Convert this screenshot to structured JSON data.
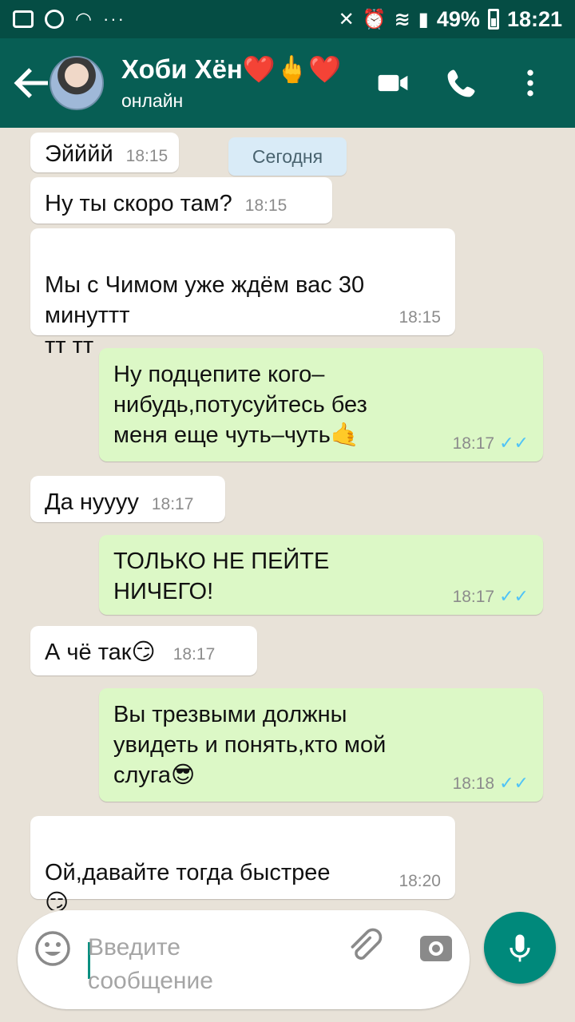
{
  "status_bar": {
    "dots": "···",
    "battery": "49%",
    "time": "18:21"
  },
  "header": {
    "contact_name": "Хоби Хён❤️🖕❤️",
    "status": "онлайн"
  },
  "date_chip": "Сегодня",
  "messages": [
    {
      "dir": "in",
      "text": "Эйййй",
      "time": "18:15"
    },
    {
      "dir": "in",
      "text": "Ну ты скоро там?",
      "time": "18:15"
    },
    {
      "dir": "in",
      "text": "Мы с Чимом уже ждём вас 30 минуттт\nтт тт",
      "time": "18:15"
    },
    {
      "dir": "out",
      "text": "Ну подцепите кого–нибудь,потусуйтесь без меня еще чуть–чуть🤙",
      "time": "18:17",
      "ticks": "✓✓"
    },
    {
      "dir": "in",
      "text": "Да нуууу",
      "time": "18:17"
    },
    {
      "dir": "out",
      "text": "ТОЛЬКО НЕ ПЕЙТЕ НИЧЕГО!",
      "time": "18:17",
      "ticks": "✓✓"
    },
    {
      "dir": "in",
      "text": "А чё так😏",
      "time": "18:17"
    },
    {
      "dir": "out",
      "text": "Вы трезвыми должны увидеть и понять,кто мой слуга😎",
      "time": "18:18",
      "ticks": "✓✓"
    },
    {
      "dir": "in",
      "text": "Ой,давайте тогда быстрее\n😏",
      "time": "18:20"
    }
  ],
  "composer": {
    "placeholder": "Введите сообщение"
  },
  "icons": {
    "back": "arrow-left-icon",
    "video": "video-camera-icon",
    "call": "phone-icon",
    "menu": "more-vert-icon",
    "emoji": "smiley-icon",
    "attach": "paperclip-icon",
    "camera": "camera-icon",
    "mic": "microphone-icon"
  },
  "colors": {
    "header": "#075e54",
    "status_bar": "#054d44",
    "outgoing": "#dcf8c6",
    "incoming": "#ffffff",
    "read_ticks": "#4fc3f7",
    "mic_button": "#00897b"
  }
}
